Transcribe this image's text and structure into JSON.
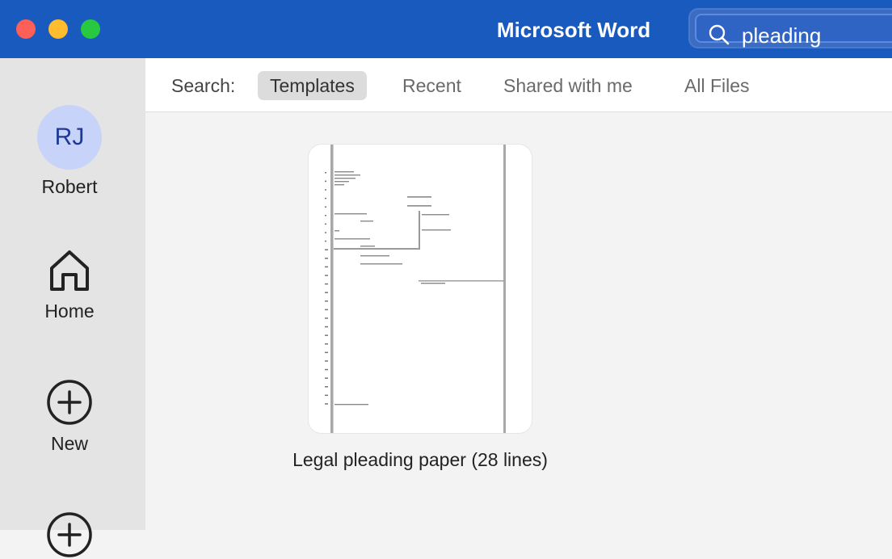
{
  "window": {
    "title": "Microsoft Word",
    "traffic_lights": [
      "close",
      "minimize",
      "zoom"
    ]
  },
  "search": {
    "value": "pleading",
    "icon": "magnifier-icon"
  },
  "sidebar": {
    "user": {
      "initials": "RJ",
      "name": "Robert"
    },
    "items": [
      {
        "label": "Home",
        "icon": "home-icon"
      },
      {
        "label": "New",
        "icon": "plus-circle-icon"
      },
      {
        "label": "",
        "icon": "plus-circle-icon"
      }
    ]
  },
  "tabs": {
    "prefix": "Search:",
    "items": [
      {
        "label": "Templates",
        "active": true
      },
      {
        "label": "Recent",
        "active": false
      },
      {
        "label": "Shared with me",
        "active": false
      },
      {
        "label": "All Files",
        "active": false
      }
    ]
  },
  "results": [
    {
      "title": "Legal pleading paper (28 lines)"
    }
  ],
  "colors": {
    "titlebar": "#185abd",
    "sidebar": "#e4e4e4",
    "avatar_bg": "#c8d3f9",
    "active_tab": "#dcdcdc"
  }
}
